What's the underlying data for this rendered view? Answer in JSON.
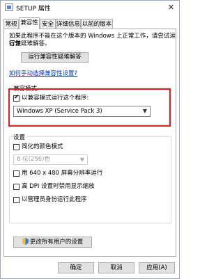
{
  "window": {
    "title": "SETUP 属性",
    "close_glyph": "✕"
  },
  "tabs": [
    "常规",
    "兼容性",
    "安全",
    "详细信息",
    "以前的版本"
  ],
  "intro": {
    "line1": "如果此程序不能在这个版本的 Windows 上正常工作，请尝试运行兼",
    "line2": "容性疑难解答。"
  },
  "troubleshoot_button": "运行兼容性疑难解答",
  "manual_link": "如何手动选择兼容性设置?",
  "compat_mode": {
    "group_title": "兼容模式",
    "checkbox_label": "以兼容模式运行这个程序:",
    "checked": true,
    "selected_os": "Windows XP (Service Pack 3)"
  },
  "settings": {
    "group_title": "设置",
    "reduced_color_label": "简化的颜色模式",
    "color_select_value": "8 位(256)色",
    "res_640_label": "用 640 x 480 屏幕分辨率运行",
    "dpi_label": "高 DPI 设置时禁用显示缩放",
    "admin_label": "以管理员身份运行此程序"
  },
  "all_users_button": "更改所有用户的设置",
  "footer": {
    "ok": "确定",
    "cancel": "取消",
    "apply": "应用(A)"
  },
  "colors": {
    "highlight": "#e02020",
    "link": "#0033cc"
  }
}
